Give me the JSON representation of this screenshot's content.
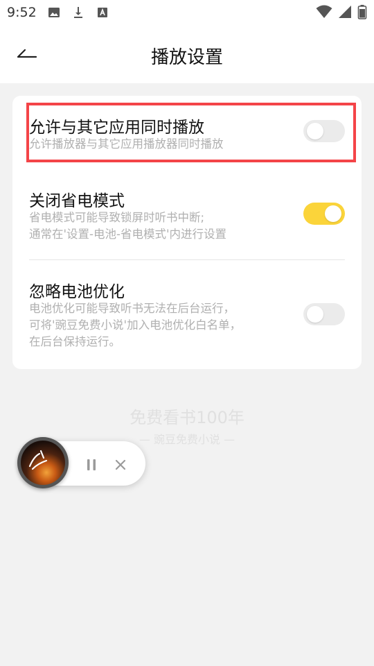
{
  "statusbar": {
    "time": "9:52",
    "icons_left": [
      "image-icon",
      "download-icon",
      "font-icon"
    ],
    "icons_right": [
      "wifi-icon",
      "signal-icon",
      "battery-icon"
    ]
  },
  "header": {
    "title": "播放设置",
    "back_icon": "back-arrow-icon"
  },
  "settings": [
    {
      "title": "允许与其它应用同时播放",
      "desc": [
        "允许播放器与其它应用播放器同时播放"
      ],
      "enabled": false
    },
    {
      "title": "关闭省电模式",
      "desc": [
        "省电模式可能导致锁屏时听书中断;",
        "通常在'设置-电池-省电模式'内进行设置"
      ],
      "enabled": true
    },
    {
      "title": "忽略电池优化",
      "desc": [
        "电池优化可能导致听书无法在后台运行，",
        "可将'豌豆免费小说'加入电池优化白名单，",
        "在后台保持运行。"
      ],
      "enabled": false
    }
  ],
  "footer": {
    "slogan": "免费看书100年",
    "brand": "— 豌豆免费小说 —"
  },
  "player": {
    "pause_icon": "pause-icon",
    "close_icon": "close-icon"
  },
  "colors": {
    "accent": "#fbd43a",
    "highlight": "#f44448",
    "background": "#f2f2f2"
  }
}
